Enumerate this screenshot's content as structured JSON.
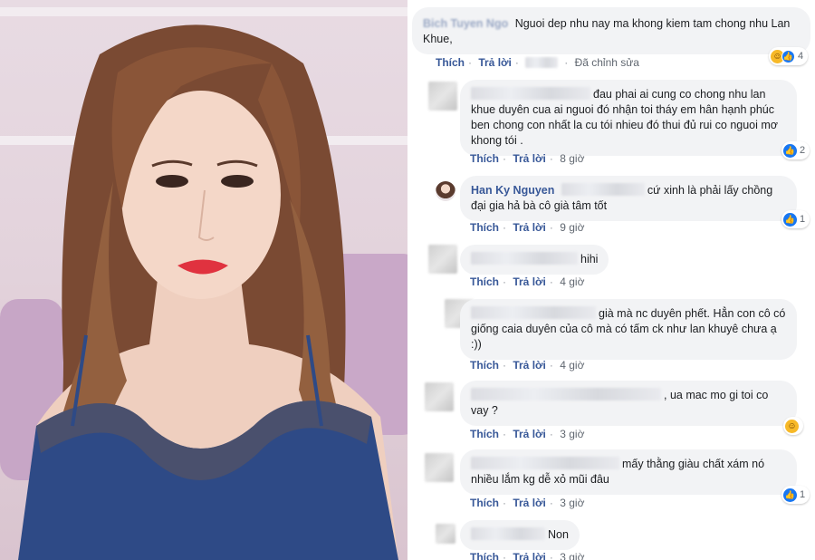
{
  "colors": {
    "accent": "#385898",
    "like": "#1877f2",
    "bubble": "#f2f3f5"
  },
  "photo": {
    "description_icon": "selfie-photo"
  },
  "comments": [
    {
      "name": "Bich Tuyen Ngo",
      "text": "Nguoi dep nhu nay ma khong kiem tam chong nhu Lan Khue,",
      "actions": {
        "like": "Thích",
        "reply": "Trả lời",
        "edited": "Đã chỉnh sửa"
      },
      "reactions": {
        "icons": [
          "haha-icon",
          "like-icon"
        ],
        "count": "4"
      }
    },
    {
      "name": "",
      "text": "đau phai ai cung co chong nhu lan khue duyên cua ai nguoi đó nhận toi tháy em hân hạnh phúc ben chong con nhất la cu tói nhieu đó thui đủ rui co nguoi mơ khong tói .",
      "actions": {
        "like": "Thích",
        "reply": "Trả lời",
        "time": "8 giờ"
      },
      "reactions": {
        "icons": [
          "like-icon"
        ],
        "count": "2"
      }
    },
    {
      "name": "Han Ky Nguyen",
      "text": "cứ xinh là phải lấy chồng đại gia hả bà cô già tâm tốt",
      "actions": {
        "like": "Thích",
        "reply": "Trả lời",
        "time": "9 giờ"
      },
      "reactions": {
        "icons": [
          "like-icon"
        ],
        "count": "1"
      }
    },
    {
      "name": "",
      "text": "hihi",
      "actions": {
        "like": "Thích",
        "reply": "Trả lời",
        "time": "4 giờ"
      }
    },
    {
      "name": "",
      "text": "già mà nc duyên phết. Hẳn con cô có giống caia duyên của cô mà có tấm ck như lan khuyê chưa ạ :))",
      "actions": {
        "like": "Thích",
        "reply": "Trả lời",
        "time": "4 giờ"
      }
    },
    {
      "name": "",
      "text": ", ua mac mo gi toi co vay ?",
      "actions": {
        "like": "Thích",
        "reply": "Trả lời",
        "time": "3 giờ"
      },
      "reactions": {
        "icons": [
          "haha-icon"
        ],
        "count": ""
      }
    },
    {
      "name": "",
      "text": "mấy thằng giàu chất xám nó nhiều lắm kg dễ xỏ mũi đâu",
      "actions": {
        "like": "Thích",
        "reply": "Trả lời",
        "time": "3 giờ"
      },
      "reactions": {
        "icons": [
          "like-icon"
        ],
        "count": "1"
      }
    },
    {
      "name": "",
      "text": "Non",
      "actions": {
        "like": "Thích",
        "reply": "Trả lời",
        "time": "3 giờ"
      }
    }
  ]
}
